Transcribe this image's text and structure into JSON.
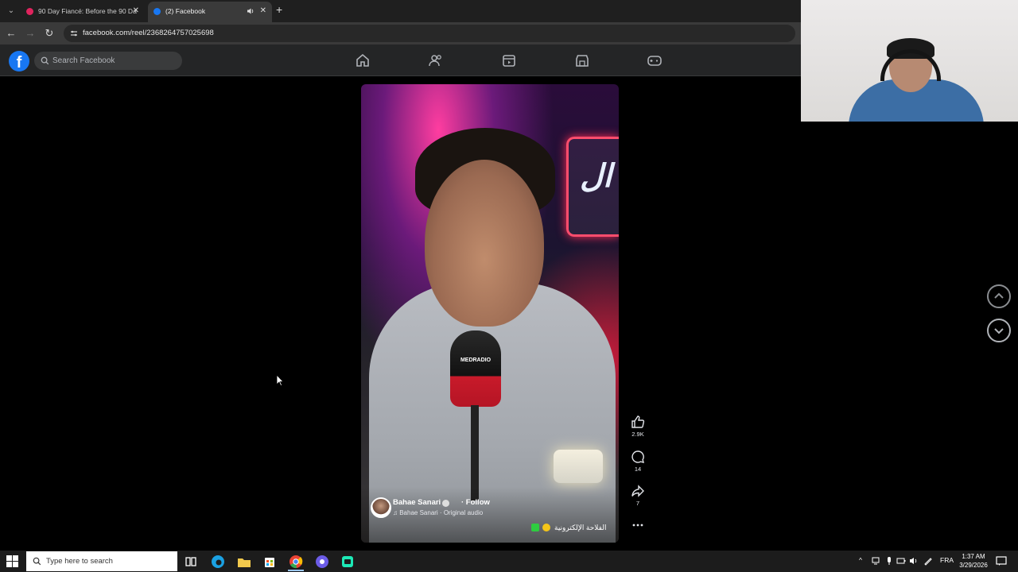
{
  "browser": {
    "tabs": [
      {
        "title": "90 Day Fiancé: Before the 90 Da",
        "favicon_color": "#e0245e"
      },
      {
        "title": "(2) Facebook",
        "favicon_color": "#1877f2",
        "audio_icon": "speaker-icon"
      }
    ],
    "url": "facebook.com/reel/2368264757025698"
  },
  "facebook": {
    "logo": "f",
    "search_placeholder": "Search Facebook",
    "nav_icons": [
      "home-icon",
      "friends-icon",
      "video-icon",
      "marketplace-icon",
      "gaming-icon"
    ]
  },
  "reel": {
    "author": "Bahae Sanari",
    "follow_label": "· Follow",
    "audio": "♫ Bahae Sanari · Original audio",
    "caption": "الفلاحة الإلكترونية",
    "mic_brand": "MEDRADIO",
    "neon_text": "ال",
    "likes": "2.9K",
    "comments": "14",
    "shares": "7"
  },
  "taskbar": {
    "search_placeholder": "Type here to search",
    "language": "FRA",
    "time": "1:37 AM",
    "date": "3/29/2026"
  },
  "colors": {
    "fb_blue": "#1877f2",
    "header_bg": "#242526"
  }
}
